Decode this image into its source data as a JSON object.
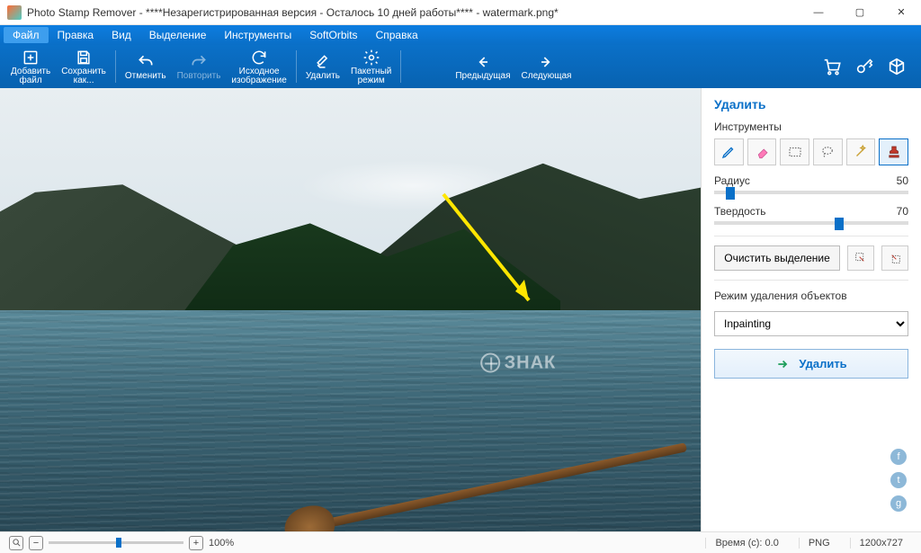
{
  "window": {
    "title": "Photo Stamp Remover - ****Незарегистрированная версия - Осталось 10 дней работы**** - watermark.png*"
  },
  "menu": {
    "items": [
      "Файл",
      "Правка",
      "Вид",
      "Выделение",
      "Инструменты",
      "SoftOrbits",
      "Справка"
    ],
    "selected": 0
  },
  "toolbar": {
    "add_file": "Добавить\nфайл",
    "save_as": "Сохранить\nкак...",
    "undo": "Отменить",
    "redo": "Повторить",
    "original": "Исходное\nизображение",
    "remove": "Удалить",
    "batch": "Пакетный\nрежим",
    "prev": "Предыдущая",
    "next": "Следующая"
  },
  "sidebar": {
    "title": "Удалить",
    "tools_label": "Инструменты",
    "radius_label": "Радиус",
    "radius_value": "50",
    "hardness_label": "Твердость",
    "hardness_value": "70",
    "clear_label": "Очистить выделение",
    "mode_label": "Режим удаления объектов",
    "mode_value": "Inpainting",
    "remove_button": "Удалить"
  },
  "canvas": {
    "watermark_text": "ЗНАК"
  },
  "statusbar": {
    "zoom": "100%",
    "time": "Время (с): 0.0",
    "format": "PNG",
    "dimensions": "1200x727"
  }
}
